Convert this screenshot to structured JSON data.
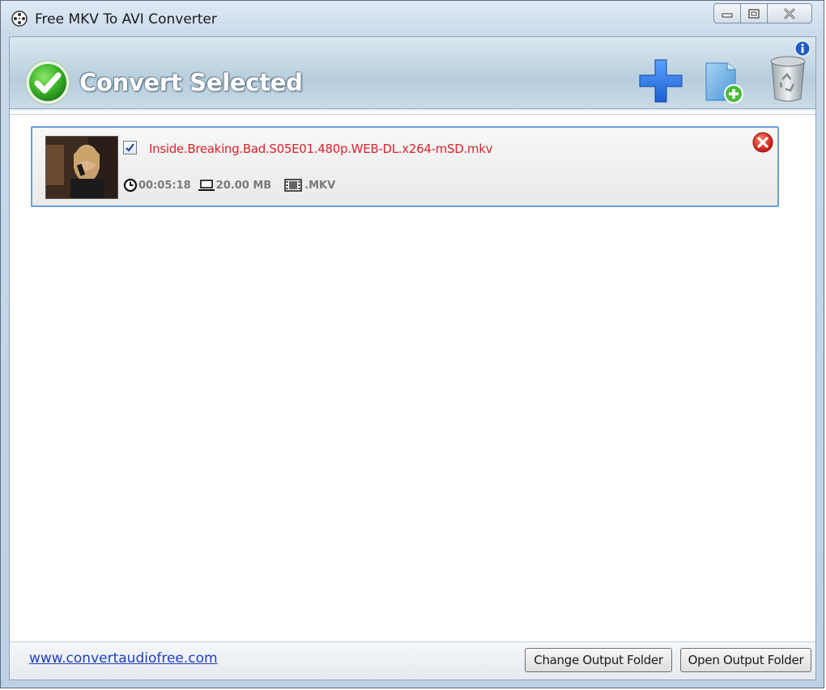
{
  "window": {
    "title": "Free MKV To AVI Converter"
  },
  "toolbar": {
    "convert_label": "Convert Selected",
    "icons": {
      "convert": "checkmark-circle-icon",
      "add": "plus-icon",
      "add_folder": "add-folder-icon",
      "trash": "recycle-bin-icon",
      "info": "info-icon"
    }
  },
  "files": [
    {
      "name": "Inside.Breaking.Bad.S05E01.480p.WEB-DL.x264-mSD.mkv",
      "checked": true,
      "duration": "00:05:18",
      "size": "20.00 MB",
      "format": ".MKV"
    }
  ],
  "footer": {
    "website": "www.convertaudiofree.com",
    "change_output_label": "Change Output Folder",
    "open_output_label": "Open Output Folder"
  },
  "colors": {
    "accent_green": "#3fb62a",
    "file_name_red": "#d9242e",
    "selection_border": "#6a9fd8",
    "link_blue": "#1f3fbf"
  }
}
